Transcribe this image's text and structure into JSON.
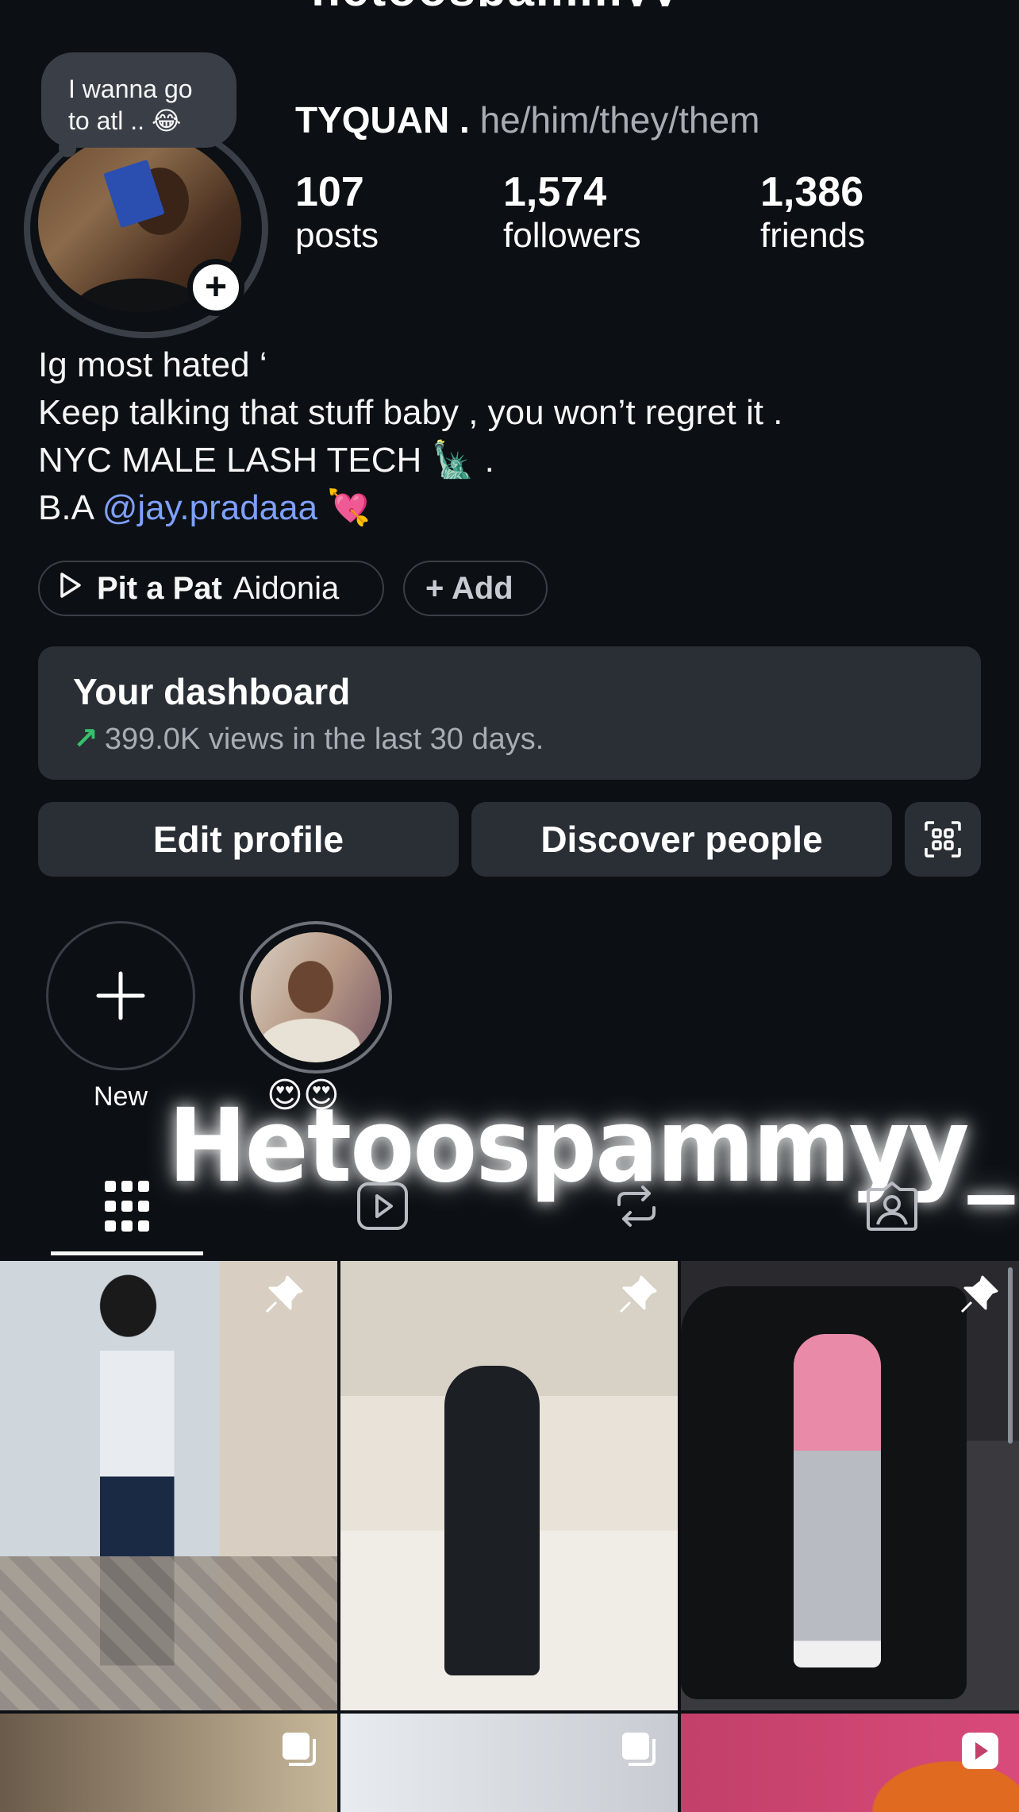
{
  "profile": {
    "username_cut": "hetoospammyy_",
    "note_line1": "I wanna go",
    "note_line2": "to atl .. 😂",
    "display_name": "TYQUAN .",
    "pronouns": "he/him/they/them",
    "stats": {
      "posts_count": "107",
      "posts_label": "posts",
      "followers_count": "1,574",
      "followers_label": "followers",
      "friends_count": "1,386",
      "friends_label": "friends"
    },
    "bio": {
      "line1": "Ig most hated ‘",
      "line2": "Keep talking that stuff baby , you won’t regret it .",
      "line3_text": "NYC MALE LASH TECH",
      "line3_emoji": "🗽",
      "line3_end": ".",
      "line4_prefix": "B.A",
      "line4_mention": "@jay.pradaaa",
      "line4_emoji": "💘"
    }
  },
  "music": {
    "title": "Pit a Pat",
    "artist": "Aidonia",
    "add_label": "+ Add"
  },
  "dashboard": {
    "title": "Your dashboard",
    "arrow": "↗",
    "subtitle": "399.0K views in the last 30 days."
  },
  "buttons": {
    "edit_profile": "Edit profile",
    "discover_people": "Discover people"
  },
  "highlights": {
    "new_label": "New",
    "second_label": "😍😍"
  },
  "overlay_text": "Hetoospammyy_",
  "tabs": [
    "grid",
    "reels",
    "reposts",
    "tagged"
  ],
  "colors": {
    "background": "#0c1014",
    "surface": "#2a2e35",
    "mention": "#7ea0ff",
    "trend_up": "#36c06a"
  }
}
